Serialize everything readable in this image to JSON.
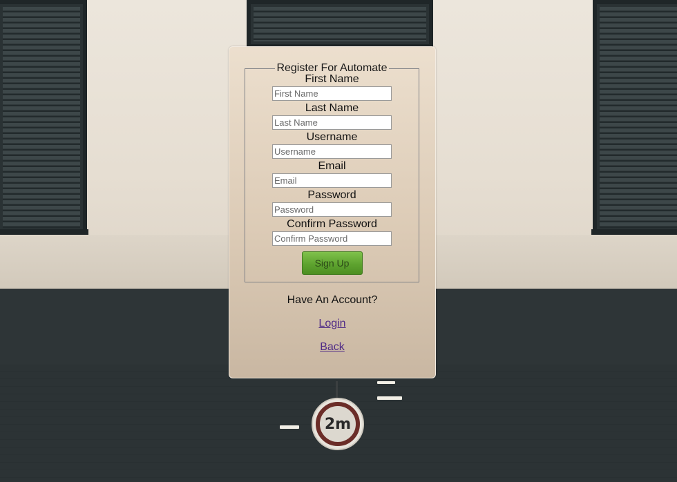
{
  "form": {
    "legend": "Register For Automate",
    "fields": [
      {
        "label": "First Name",
        "placeholder": "First Name"
      },
      {
        "label": "Last Name",
        "placeholder": "Last Name"
      },
      {
        "label": "Username",
        "placeholder": "Username"
      },
      {
        "label": "Email",
        "placeholder": "Email"
      },
      {
        "label": "Password",
        "placeholder": "Password"
      },
      {
        "label": "Confirm Password",
        "placeholder": "Confirm Password"
      }
    ],
    "submit_label": "Sign Up"
  },
  "account": {
    "prompt": "Have An Account?",
    "login_label": "Login",
    "back_label": "Back"
  },
  "background": {
    "sign_text": "2m"
  },
  "colors": {
    "button_green": "#5ea32f",
    "link_purple": "#4f2a86",
    "panel_tan": "#dccbb6"
  }
}
